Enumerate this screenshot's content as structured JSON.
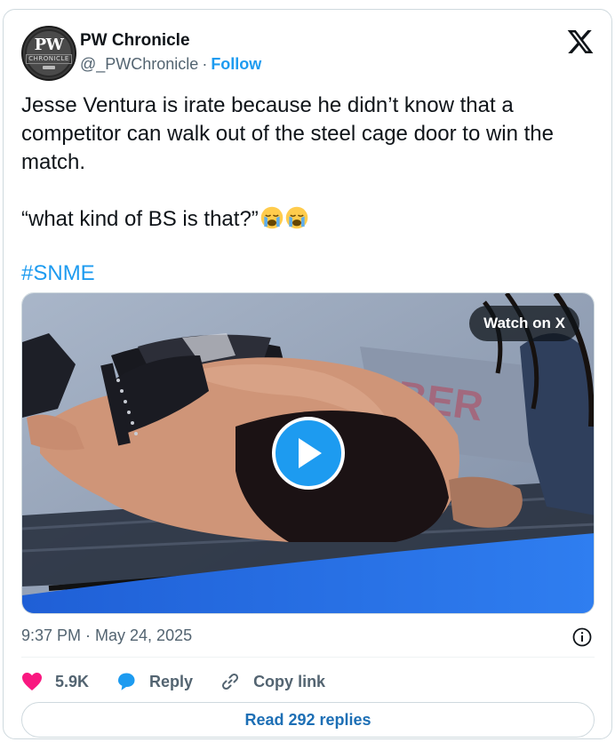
{
  "author": {
    "name": "PW Chronicle",
    "handle": "@_PWChronicle",
    "separator": "·",
    "follow_label": "Follow",
    "avatar_text_top": "PW",
    "avatar_text_bottom": "CHRONICLE"
  },
  "tweet": {
    "text": "Jesse Ventura is irate because he didn’t know that a competitor can walk out of the steel cage door to win the match.\n\n“what kind of BS is that?”",
    "emojis": [
      "loudly-crying-face",
      "loudly-crying-face"
    ],
    "hashtag": "#SNME"
  },
  "media": {
    "watch_label": "Watch on X",
    "type": "video"
  },
  "meta": {
    "timestamp": "9:37 PM · May 24, 2025"
  },
  "actions": {
    "likes": "5.9K",
    "reply_label": "Reply",
    "copy_link_label": "Copy link"
  },
  "footer": {
    "read_replies_label": "Read 292 replies"
  },
  "colors": {
    "accent": "#1d9bf0",
    "heart": "#f91880",
    "muted": "#536471",
    "text": "#0f1419",
    "border": "#cfd9de"
  }
}
